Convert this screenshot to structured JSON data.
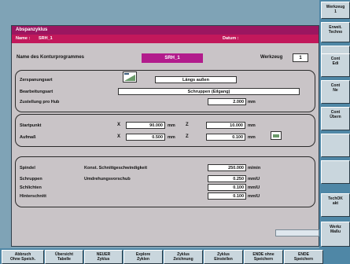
{
  "window": {
    "title": "Abspanzyklus",
    "name_label": "Name :",
    "name_value": "SRH_1",
    "date_label": "Datum :"
  },
  "program": {
    "label": "Name des Konturprogrammes",
    "value": "SRH_1",
    "tool_label": "Werkzeug",
    "tool_value": "1"
  },
  "group1": {
    "zerspanungsart_label": "Zerspanungsart",
    "zerspanungsart_value": "Längs außen",
    "bearbeitungsart_label": "Bearbeitungsart",
    "bearbeitungsart_value": "Schruppen (Eilgang)",
    "zustellung_label": "Zustellung pro Hub",
    "zustellung_value": "2.000",
    "zustellung_unit": "mm"
  },
  "group2": {
    "startpunkt_label": "Startpunkt",
    "startpunkt_x": "90.000",
    "startpunkt_z": "10.000",
    "aufmass_label": "Aufmaß",
    "aufmass_x": "0.500",
    "aufmass_z": "0.100",
    "x_axis": "X",
    "z_axis": "Z",
    "unit": "mm"
  },
  "group3": {
    "spindel_label": "Spindel",
    "spindel_mode": "Konst. Schnittgeschwindigkeit",
    "spindel_value": "250.000",
    "spindel_unit": "m/min",
    "schruppen_label": "Schruppen",
    "schlichten_label": "Schlichten",
    "hinterschnitt_label": "Hinterschnitt",
    "vorschub_label": "Umdrehungsvorschub",
    "schruppen_value": "0.250",
    "schlichten_value": "0.100",
    "hinterschnitt_value": "0.100",
    "feed_unit": "mm/U"
  },
  "right_softkeys": [
    {
      "label": "Werkzeug\n1"
    },
    {
      "label": "Erweit.\nTechno"
    },
    {
      "label": ""
    },
    {
      "label": "Cont\nEdi"
    },
    {
      "label": "Cont\nNe"
    },
    {
      "label": "Cont\nÜbern"
    },
    {
      "label": ""
    },
    {
      "label": ""
    },
    {
      "label": "TechOK\nakt"
    },
    {
      "label": "Werkz\nMaßu"
    }
  ],
  "bottom_softkeys": [
    {
      "label": "Abbruch\nOhne Speich."
    },
    {
      "label": "Übersicht\nTabelle"
    },
    {
      "label": "NEUER\nZyklus"
    },
    {
      "label": "Explore\nZyklen"
    },
    {
      "label": "Zyklus\nZeichnung"
    },
    {
      "label": "Zyklus\nEinstellen"
    },
    {
      "label": "ENDE ohne\nSpeichern"
    },
    {
      "label": "ENDE\nSpeichern"
    }
  ]
}
